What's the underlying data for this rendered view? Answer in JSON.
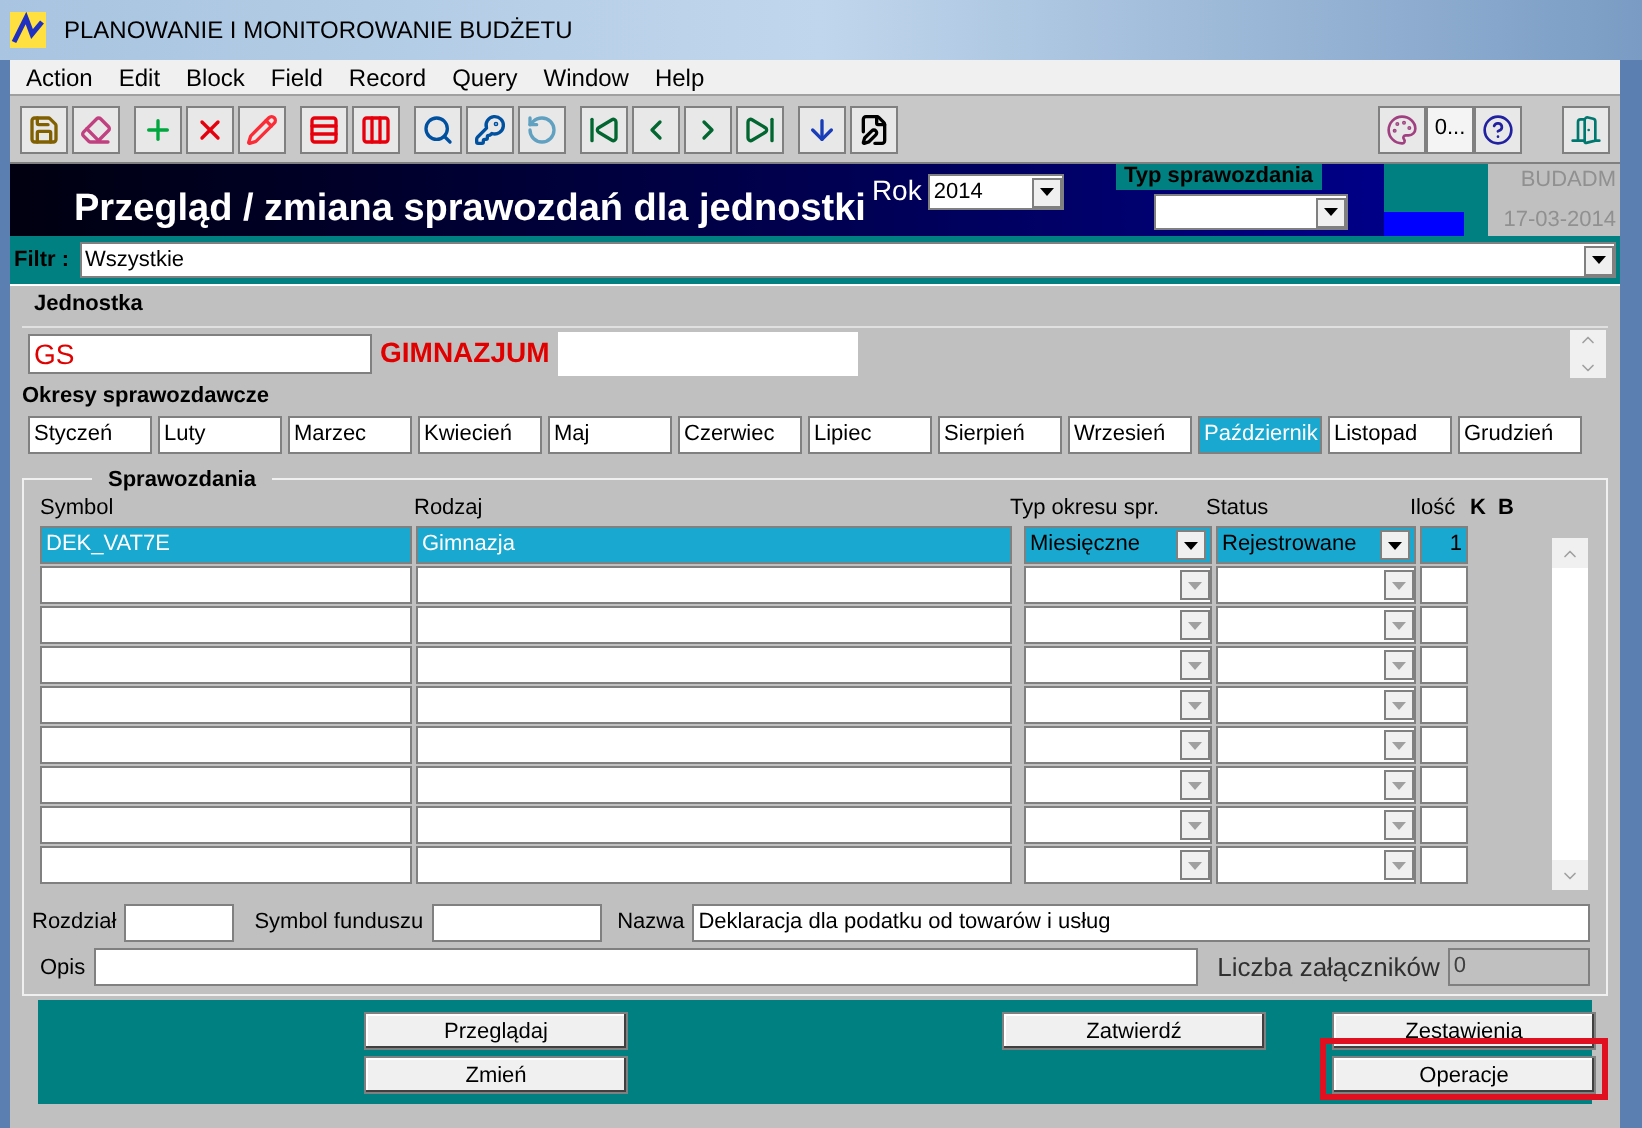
{
  "window": {
    "title": "PLANOWANIE I MONITOROWANIE BUDŻETU"
  },
  "menu": [
    "Action",
    "Edit",
    "Block",
    "Field",
    "Record",
    "Query",
    "Window",
    "Help"
  ],
  "toolbar_right_button": "0...",
  "header": {
    "title": "Przegląd / zmiana  sprawozdań dla jednostki",
    "year_label": "Rok",
    "year": "2014",
    "report_type_label": "Typ sprawozdania",
    "user": "BUDADM",
    "date": "17-03-2014"
  },
  "filter": {
    "label": "Filtr :",
    "value": "Wszystkie"
  },
  "unit": {
    "label": "Jednostka",
    "code": "GS",
    "name": "GIMNAZJUM"
  },
  "periods": {
    "label": "Okresy sprawozdawcze",
    "items": [
      {
        "label": "Styczeń",
        "selected": false
      },
      {
        "label": "Luty",
        "selected": false
      },
      {
        "label": "Marzec",
        "selected": false
      },
      {
        "label": "Kwiecień",
        "selected": false
      },
      {
        "label": "Maj",
        "selected": false
      },
      {
        "label": "Czerwiec",
        "selected": false
      },
      {
        "label": "Lipiec",
        "selected": false
      },
      {
        "label": "Sierpień",
        "selected": false
      },
      {
        "label": "Wrzesień",
        "selected": false
      },
      {
        "label": "Październik",
        "selected": true
      },
      {
        "label": "Listopad",
        "selected": false
      },
      {
        "label": "Grudzień",
        "selected": false
      }
    ]
  },
  "reports": {
    "label": "Sprawozdania",
    "columns": [
      "Symbol",
      "Rodzaj",
      "Typ okresu spr.",
      "Status",
      "Ilość",
      "K",
      "B"
    ],
    "rows": [
      {
        "symbol": "DEK_VAT7E",
        "kind": "Gimnazja",
        "period_type": "Miesięczne",
        "status": "Rejestrowane",
        "count": "1",
        "selected": true
      }
    ]
  },
  "details": {
    "chapter_label": "Rozdział",
    "fund_label": "Symbol funduszu",
    "name_label": "Nazwa",
    "name": "Deklaracja dla podatku od towarów i usług",
    "description_label": "Opis",
    "attachments_label": "Liczba załączników",
    "attachments": "0"
  },
  "buttons": [
    {
      "label": "Przeglądaj",
      "highlighted": false
    },
    {
      "label": "Zatwierdź",
      "highlighted": false
    },
    {
      "label": "Zestawienia",
      "highlighted": false
    },
    {
      "label": "Zmień",
      "highlighted": false
    },
    {
      "label": "Operacje",
      "highlighted": true
    }
  ]
}
